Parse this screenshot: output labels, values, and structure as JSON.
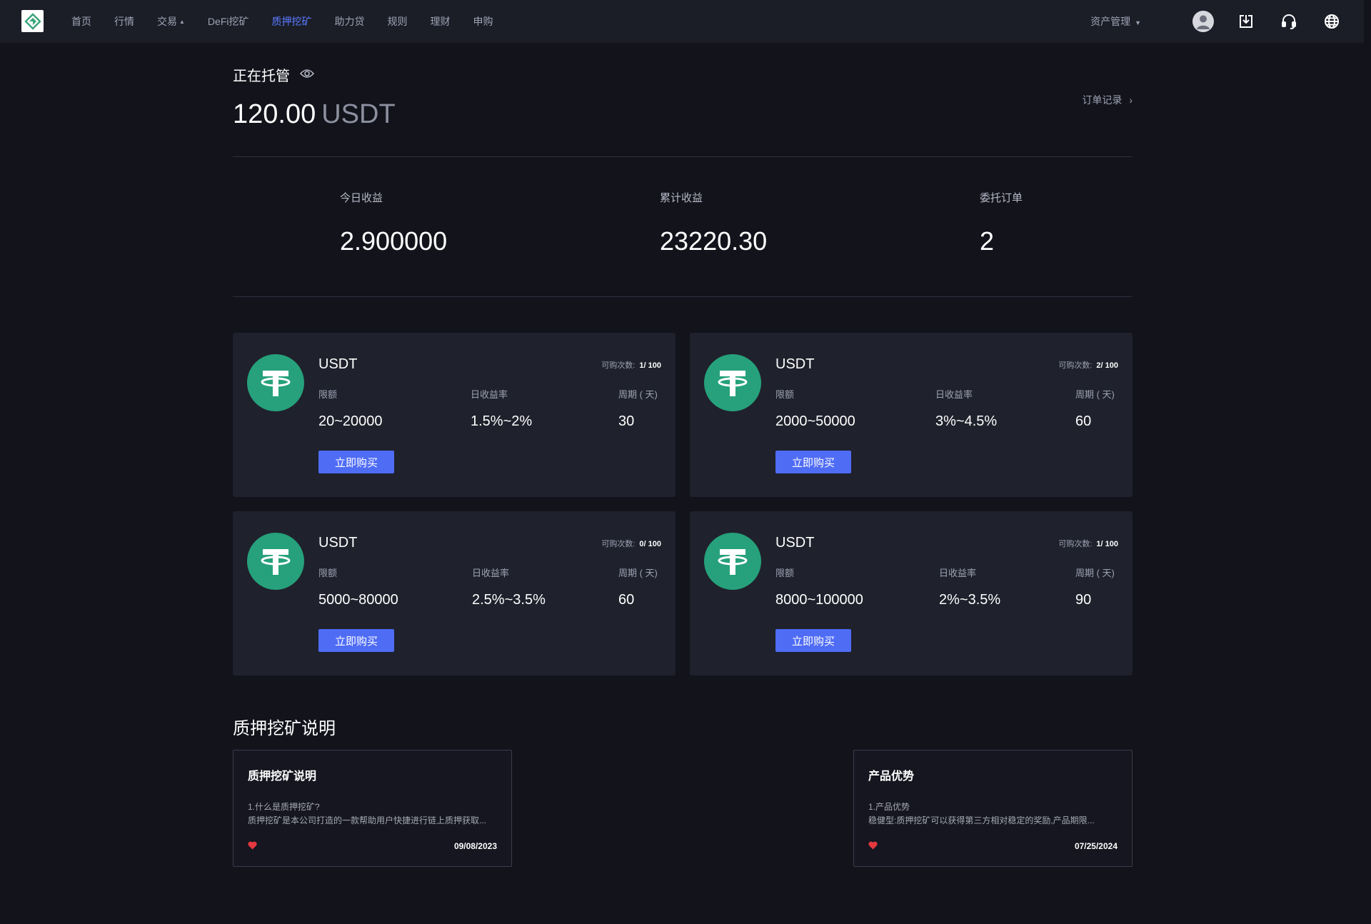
{
  "nav": {
    "items": [
      {
        "label": "首页"
      },
      {
        "label": "行情"
      },
      {
        "label": "交易"
      },
      {
        "label": "DeFi挖矿"
      },
      {
        "label": "质押挖矿"
      },
      {
        "label": "助力贷"
      },
      {
        "label": "规则"
      },
      {
        "label": "理财"
      },
      {
        "label": "申购"
      }
    ],
    "active": "质押挖矿",
    "assets_label": "资产管理"
  },
  "hosting": {
    "title": "正在托管",
    "amount": "120.00",
    "unit": "USDT",
    "order_link": "订单记录"
  },
  "stats": [
    {
      "label": "今日收益",
      "value": "2.900000"
    },
    {
      "label": "累计收益",
      "value": "23220.30"
    },
    {
      "label": "委托订单",
      "value": "2"
    }
  ],
  "products": [
    {
      "coin": "USDT",
      "quota_label": "可购次数:",
      "quota": "1/ 100",
      "limit_label": "限额",
      "limit": "20~20000",
      "rate_label": "日收益率",
      "rate": "1.5%~2%",
      "period_label": "周期 ( 天)",
      "period": "30",
      "buy_label": "立即购买"
    },
    {
      "coin": "USDT",
      "quota_label": "可购次数:",
      "quota": "2/ 100",
      "limit_label": "限额",
      "limit": "2000~50000",
      "rate_label": "日收益率",
      "rate": "3%~4.5%",
      "period_label": "周期 ( 天)",
      "period": "60",
      "buy_label": "立即购买"
    },
    {
      "coin": "USDT",
      "quota_label": "可购次数:",
      "quota": "0/ 100",
      "limit_label": "限额",
      "limit": "5000~80000",
      "rate_label": "日收益率",
      "rate": "2.5%~3.5%",
      "period_label": "周期 ( 天)",
      "period": "60",
      "buy_label": "立即购买"
    },
    {
      "coin": "USDT",
      "quota_label": "可购次数:",
      "quota": "1/ 100",
      "limit_label": "限额",
      "limit": "8000~100000",
      "rate_label": "日收益率",
      "rate": "2%~3.5%",
      "period_label": "周期 ( 天)",
      "period": "90",
      "buy_label": "立即购买"
    }
  ],
  "explain": {
    "title": "质押挖矿说明",
    "cards": [
      {
        "title": "质押挖矿说明",
        "line1": "1.什么是质押挖矿?",
        "line2": "质押挖矿是本公司打造的一款帮助用户快捷进行链上质押获取...",
        "date": "09/08/2023"
      },
      {
        "title": "产品优势",
        "line1": "1.产品优势",
        "line2": "稳健型:质押挖矿可以获得第三方相对稳定的奖励,产品期限...",
        "date": "07/25/2024"
      }
    ]
  },
  "colors": {
    "accent": "#4f6cf5",
    "active_nav": "#5b7cff",
    "tether_green": "#26a17b",
    "heart": "#e5393f"
  }
}
